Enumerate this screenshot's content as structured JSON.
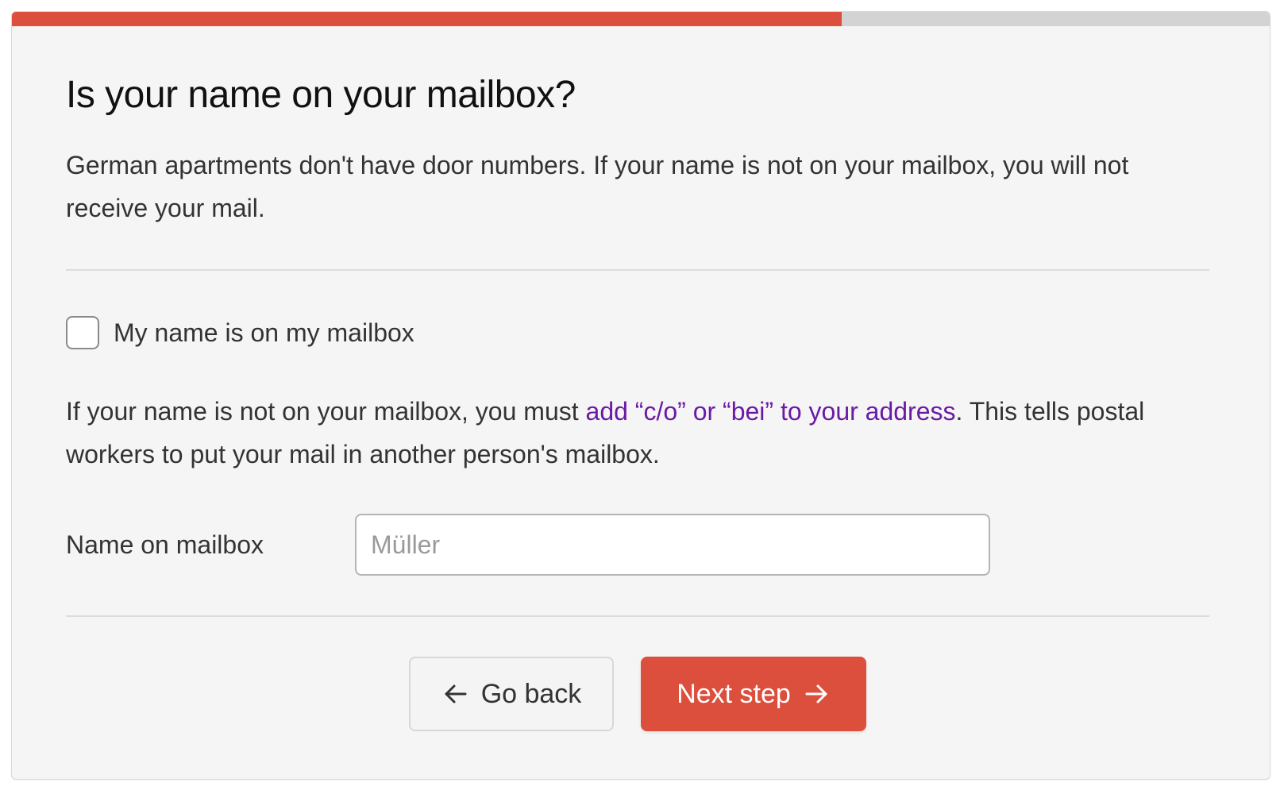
{
  "progress": {
    "fraction": 0.66,
    "fill_color": "#dc4f3c",
    "track_color": "#d3d3d3"
  },
  "page": {
    "title": "Is your name on your mailbox?",
    "intro": "German apartments don't have door numbers. If your name is not on your mailbox, you will not receive your mail."
  },
  "checkbox": {
    "label": "My name is on my mailbox",
    "checked": false
  },
  "explanation": {
    "before_link": "If your name is not on your mailbox, you must ",
    "link_text": "add “c/o” or “bei” to your address",
    "after_link": ". This tells postal workers to put your mail in another person's mailbox.",
    "link_color": "#6a1aa6"
  },
  "mailbox_field": {
    "label": "Name on mailbox",
    "value": "",
    "placeholder": "Müller"
  },
  "buttons": {
    "back_label": "Go back",
    "back_icon": "arrow-left-icon",
    "next_label": "Next step",
    "next_icon": "arrow-right-icon",
    "next_color": "#dc4f3c"
  }
}
